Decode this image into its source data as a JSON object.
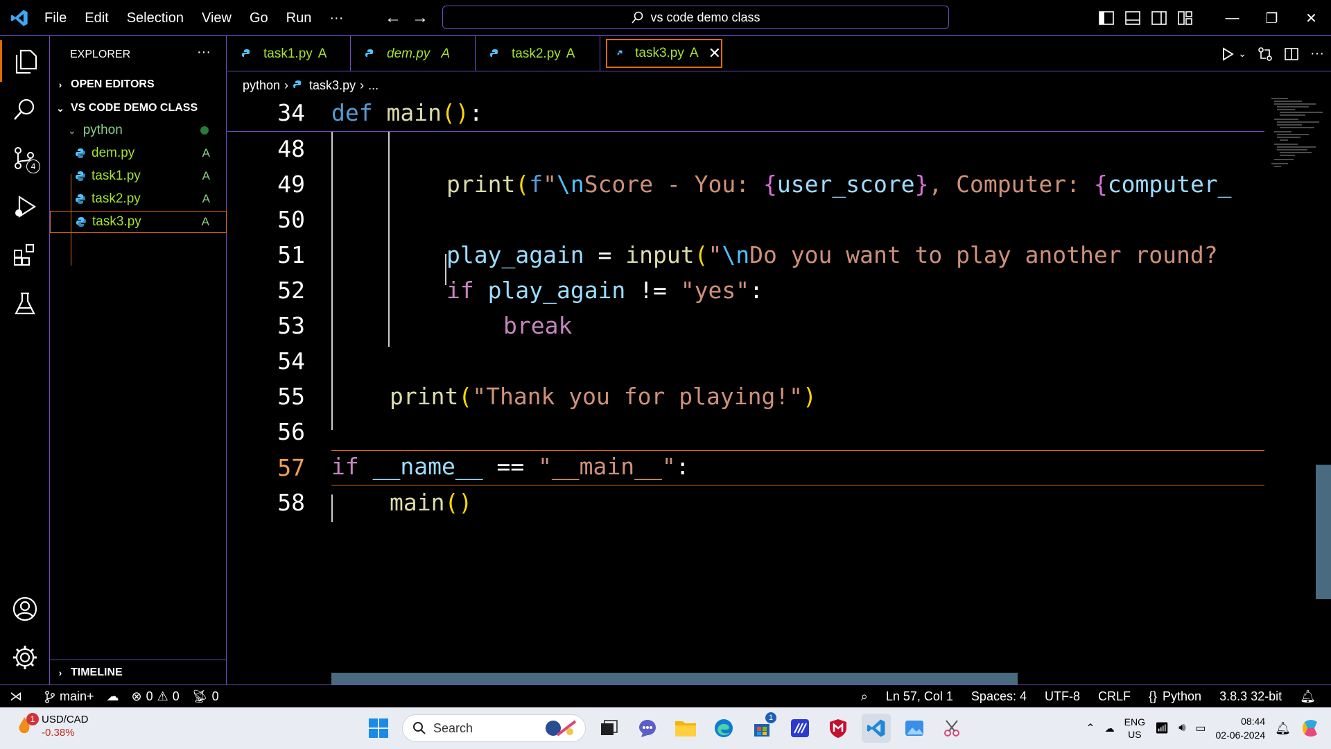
{
  "titlebar": {
    "menu": [
      "File",
      "Edit",
      "Selection",
      "View",
      "Go",
      "Run",
      "···"
    ],
    "command_center": "vs code demo class"
  },
  "activitybar": {
    "items": [
      "explorer-icon",
      "search-icon",
      "source-control-icon",
      "run-debug-icon",
      "extensions-icon",
      "testing-icon"
    ],
    "source_control_badge": "4"
  },
  "sidebar": {
    "title": "EXPLORER",
    "more": "···",
    "open_editors": "OPEN EDITORS",
    "workspace": "VS CODE DEMO CLASS",
    "folder": "python",
    "files": [
      {
        "name": "dem.py",
        "status": "A"
      },
      {
        "name": "task1.py",
        "status": "A"
      },
      {
        "name": "task2.py",
        "status": "A"
      },
      {
        "name": "task3.py",
        "status": "A"
      }
    ],
    "timeline": "TIMELINE"
  },
  "tabs": [
    {
      "label": "task1.py",
      "status": "A"
    },
    {
      "label": "dem.py",
      "status": "A"
    },
    {
      "label": "task2.py",
      "status": "A"
    },
    {
      "label": "task3.py",
      "status": "A"
    }
  ],
  "breadcrumb": {
    "folder": "python",
    "file": "task3.py",
    "rest": "..."
  },
  "editor": {
    "sticky_line_number": "34",
    "line_numbers": [
      "48",
      "49",
      "50",
      "51",
      "52",
      "53",
      "54",
      "55",
      "56",
      "57",
      "58"
    ]
  },
  "statusbar": {
    "branch": "main+",
    "errors": "0",
    "warnings": "0",
    "ports": "0",
    "position": "Ln 57, Col 1",
    "spaces": "Spaces: 4",
    "encoding": "UTF-8",
    "eol": "CRLF",
    "language": "Python",
    "interpreter": "3.8.3 32-bit"
  },
  "taskbar": {
    "ticker": "USD/CAD",
    "ticker_change": "-0.38%",
    "ticker_badge": "1",
    "search_placeholder": "Search",
    "store_badge": "1",
    "lang_top": "ENG",
    "lang_bottom": "US",
    "time": "08:44",
    "date": "02-06-2024"
  },
  "colors": {
    "accent_purple": "#6f4cc0",
    "accent_orange": "#e06c00",
    "git_added": "#a6e22e"
  }
}
